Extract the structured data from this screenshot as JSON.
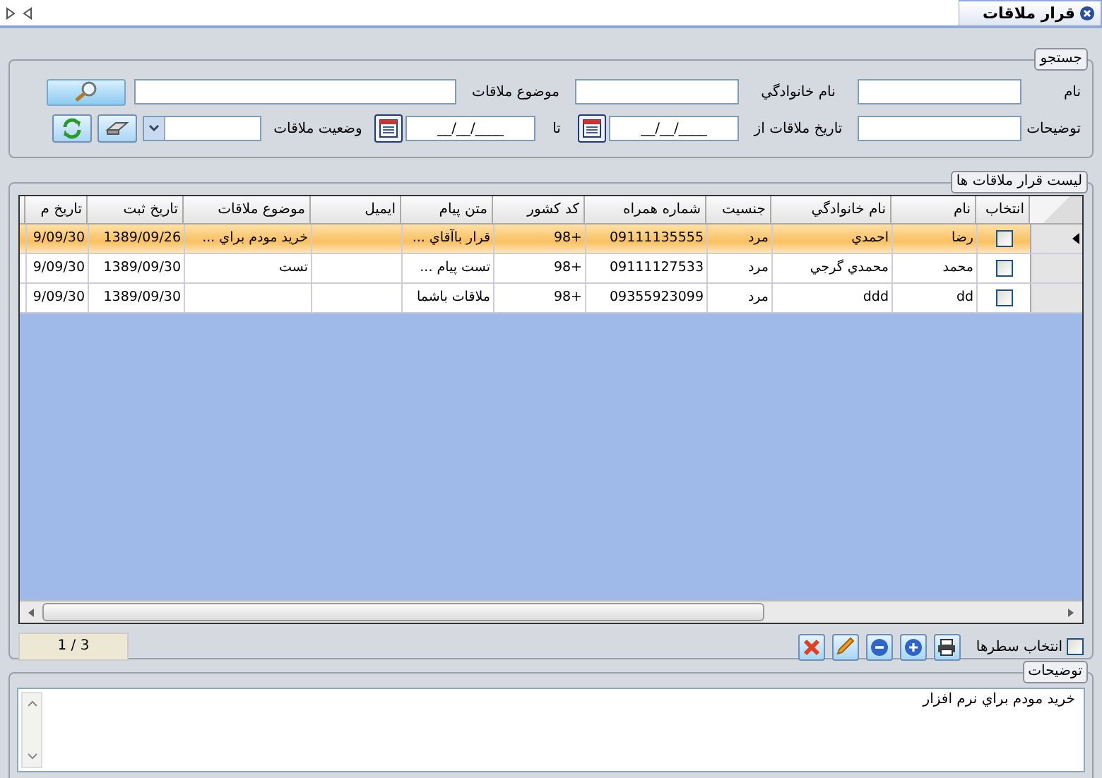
{
  "tab": {
    "title": "قرار ملاقات"
  },
  "search": {
    "legend": "جستجو",
    "first_name": {
      "label": "نام"
    },
    "last_name": {
      "label": "نام خانوادگي"
    },
    "subject": {
      "label": "موضوع ملاقات"
    },
    "notes": {
      "label": "توضيحات"
    },
    "date_from": {
      "label": "تاريخ ملاقات از",
      "value": "__/__/____"
    },
    "date_to": {
      "label": "تا",
      "value": "__/__/____"
    },
    "status": {
      "label": "وضعيت ملاقات"
    }
  },
  "grid": {
    "legend": "ليست قرار ملاقات ها",
    "select_header": "انتخاب",
    "columns": [
      "نام",
      "نام خانوادگي",
      "جنسيت",
      "شماره همراه",
      "کد کشور",
      "متن پيام",
      "ايميل",
      "موضوع ملاقات",
      "تاريخ ثبت",
      "تاريخ م"
    ],
    "rows": [
      {
        "selected": true,
        "checked": false,
        "cells": [
          "رضا",
          "احمدي",
          "مرد",
          "09111135555",
          "+98",
          "قرار باآقاي ...",
          "",
          "خريد مودم براي ...",
          "1389/09/26",
          "9/09/30"
        ]
      },
      {
        "selected": false,
        "checked": false,
        "cells": [
          "محمد",
          "محمدي گرجي",
          "مرد",
          "09111127533",
          "+98",
          "تست پيام ...",
          "",
          "تست",
          "1389/09/30",
          "9/09/30"
        ]
      },
      {
        "selected": false,
        "checked": false,
        "cells": [
          "dd",
          "ddd",
          "مرد",
          "09355923099",
          "+98",
          "ملاقات باشما",
          "",
          "",
          "1389/09/30",
          "9/09/30"
        ]
      }
    ],
    "select_rows": {
      "label": "انتخاب سطرها",
      "checked": false
    },
    "pager": "1 / 3"
  },
  "notes": {
    "legend": "توضيحات",
    "text": "خريد مودم براي نرم افزار"
  }
}
